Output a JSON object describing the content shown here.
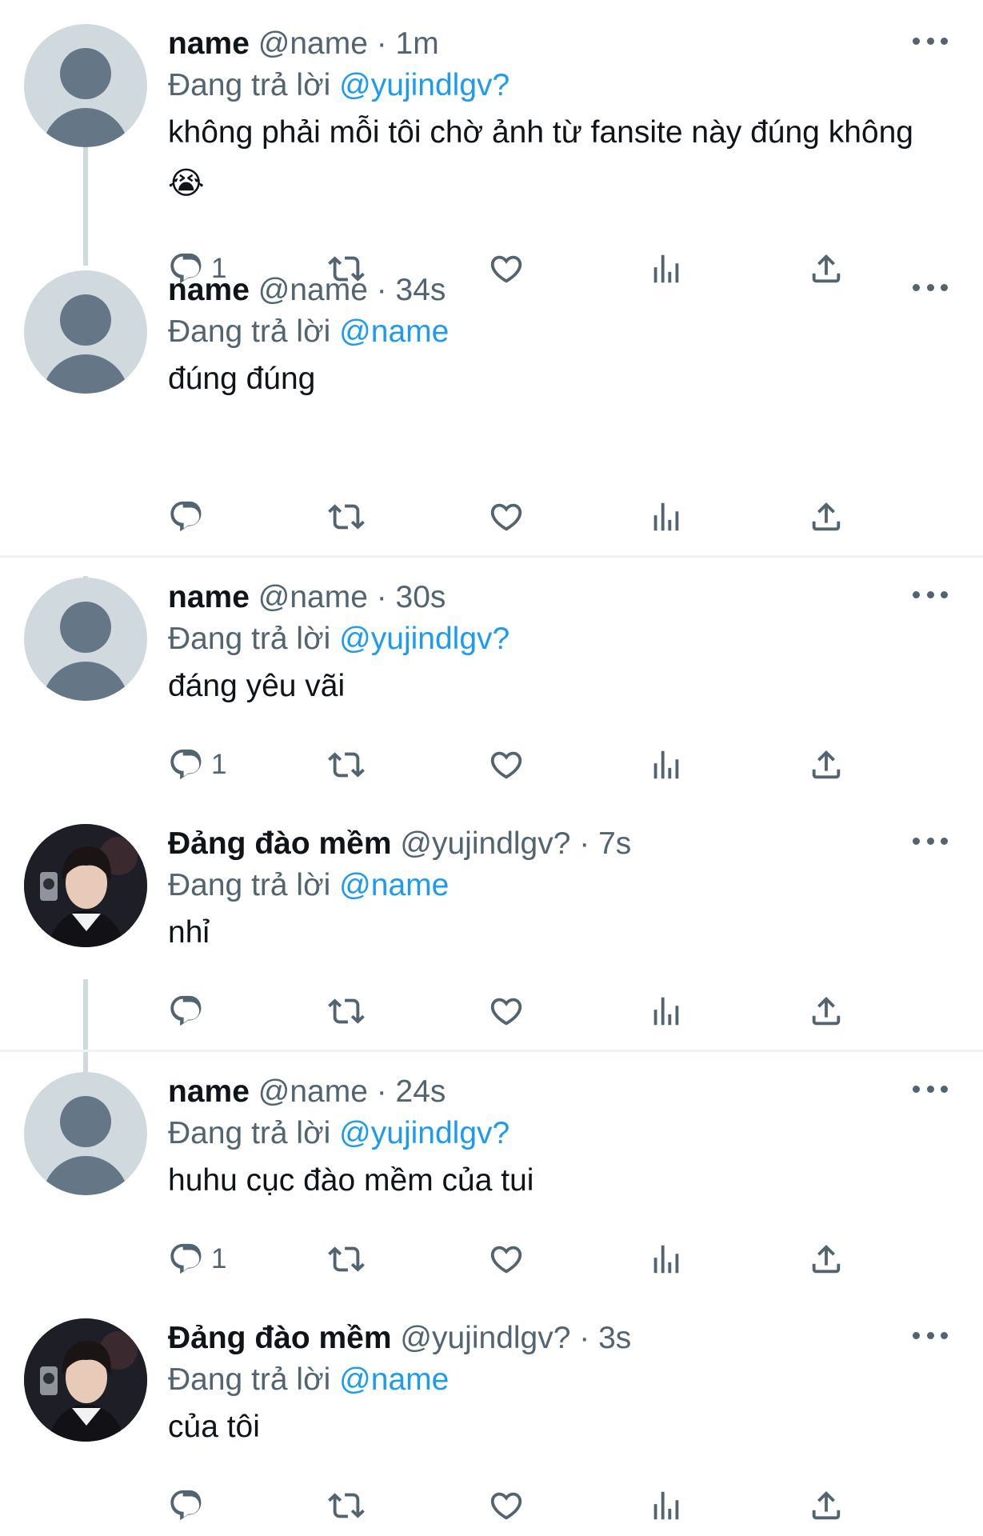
{
  "tweets": [
    {
      "name": "name",
      "handle": "@name",
      "time": "· 1m",
      "reply_prefix": "Đang trả lời",
      "reply_to": "@yujindlgv?",
      "text": "không phải mỗi tôi chờ ảnh từ fansite này đúng không 😭",
      "reply_count": "1",
      "avatar": "default"
    },
    {
      "name": "name",
      "handle": "@name",
      "time": "· 34s",
      "reply_prefix": "Đang trả lời",
      "reply_to": "@name",
      "text": "đúng đúng",
      "reply_count": "",
      "avatar": "default"
    },
    {
      "name": "name",
      "handle": "@name",
      "time": "· 30s",
      "reply_prefix": "Đang trả lời",
      "reply_to": "@yujindlgv?",
      "text": "đáng yêu vãi",
      "reply_count": "1",
      "avatar": "default"
    },
    {
      "name": "Đảng đào mềm",
      "handle": "@yujindlgv?",
      "time": "· 7s",
      "reply_prefix": "Đang trả lời",
      "reply_to": "@name",
      "text": "nhỉ",
      "reply_count": "",
      "avatar": "photo"
    },
    {
      "name": "name",
      "handle": "@name",
      "time": "· 24s",
      "reply_prefix": "Đang trả lời",
      "reply_to": "@yujindlgv?",
      "text": "huhu cục đào mềm của tui",
      "reply_count": "1",
      "avatar": "default"
    },
    {
      "name": "Đảng đào mềm",
      "handle": "@yujindlgv?",
      "time": "· 3s",
      "reply_prefix": "Đang trả lời",
      "reply_to": "@name",
      "text": "của tôi",
      "reply_count": "",
      "avatar": "photo"
    }
  ],
  "icons": {
    "reply": "reply-icon",
    "retweet": "retweet-icon",
    "like": "heart-icon",
    "views": "analytics-icon",
    "share": "share-icon",
    "more": "more-icon"
  },
  "colors": {
    "mention": "#1d9bf0",
    "secondary_text": "#536471",
    "primary_text": "#0f1419",
    "avatar_bg": "#cfd9de",
    "divider": "#eff3f4"
  }
}
